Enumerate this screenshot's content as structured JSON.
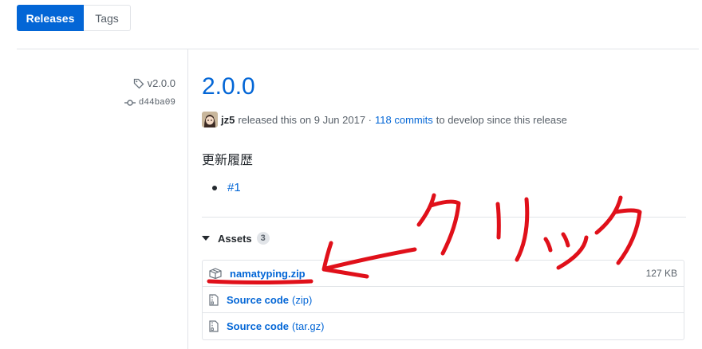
{
  "tabs": {
    "releases": "Releases",
    "tags": "Tags"
  },
  "sidebar": {
    "tag": "v2.0.0",
    "commit": "d44ba09"
  },
  "release": {
    "title": "2.0.0",
    "author": "jz5",
    "released_text": "released this on 9 Jun 2017 ·",
    "commits_link": "118 commits",
    "commits_suffix": "to develop since this release"
  },
  "notes": {
    "heading": "更新履歴",
    "items": [
      {
        "label": "#1"
      }
    ]
  },
  "assets": {
    "heading": "Assets",
    "count": "3",
    "items": [
      {
        "name": "namatyping.zip",
        "ext": "",
        "size": "127 KB",
        "icon": "package-icon"
      },
      {
        "name": "Source code",
        "ext": "(zip)",
        "size": "",
        "icon": "file-zip-icon"
      },
      {
        "name": "Source code",
        "ext": "(tar.gz)",
        "size": "",
        "icon": "file-zip-icon"
      }
    ]
  },
  "annotation": {
    "text": "クリック",
    "color": "#e0101a"
  },
  "colors": {
    "accent": "#0366d6",
    "annotation": "#e0101a"
  }
}
